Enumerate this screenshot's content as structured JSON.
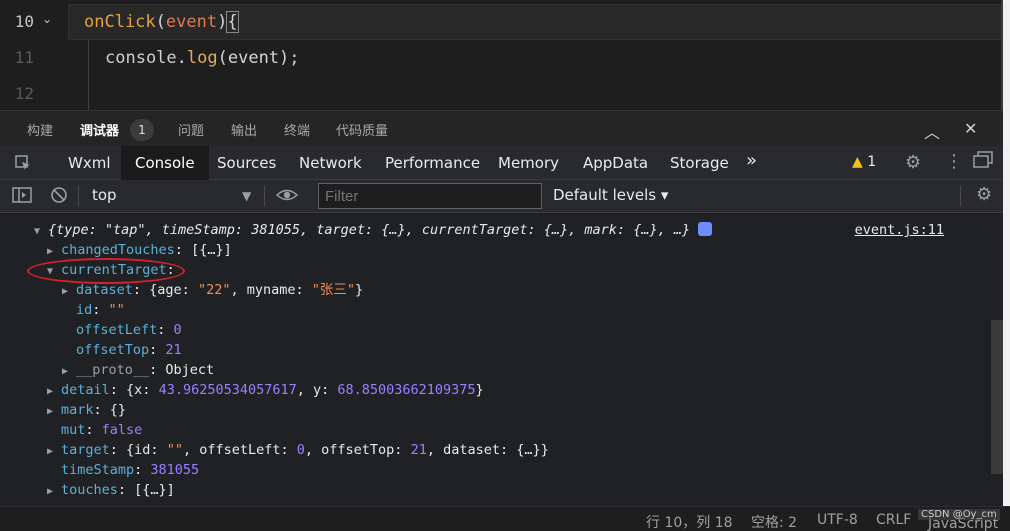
{
  "editor": {
    "lines": [
      {
        "num": "10",
        "active": true
      },
      {
        "num": "11",
        "active": false
      },
      {
        "num": "12",
        "active": false
      }
    ],
    "code_line10": {
      "func": "onClick",
      "open_paren": "(",
      "param": "event",
      "close_paren": ")",
      "brace": "{"
    },
    "code_line11": {
      "obj": "console",
      "dot": ".",
      "method": "log",
      "args": "(event);"
    }
  },
  "panel_tabs": {
    "items": [
      "构建",
      "调试器",
      "问题",
      "输出",
      "终端",
      "代码质量"
    ],
    "active": "调试器",
    "badge": "1",
    "chevron_up": "︿",
    "close": "✕"
  },
  "devtools": {
    "tabs": [
      "Wxml",
      "Console",
      "Sources",
      "Network",
      "Performance",
      "Memory",
      "AppData",
      "Storage"
    ],
    "active_tab": "Console",
    "more": "»",
    "warning_count": "1"
  },
  "console_toolbar": {
    "context": "top",
    "filter_placeholder": "Filter",
    "levels": "Default levels ▾"
  },
  "console": {
    "summary": {
      "text": "{type: \"tap\", timeStamp: 381055, target: {…}, currentTarget: {…}, mark: {…}, …}",
      "source": "event.js:11"
    },
    "changedTouches": {
      "key": "changedTouches",
      "value": "[{…}]"
    },
    "currentTarget": {
      "key": "currentTarget",
      "colon": ":"
    },
    "dataset": {
      "key": "dataset",
      "pre": "{age: ",
      "age": "\"22\"",
      "mid": ", myname: ",
      "myname": "\"张三\"",
      "post": "}"
    },
    "id": {
      "key": "id",
      "value": "\"\""
    },
    "offsetLeft": {
      "key": "offsetLeft",
      "value": "0"
    },
    "offsetTop": {
      "key": "offsetTop",
      "value": "21"
    },
    "proto": {
      "key": "__proto__",
      "value": "Object"
    },
    "detail": {
      "key": "detail",
      "pre": "{x: ",
      "x": "43.96250534057617",
      "mid": ", y: ",
      "y": "68.85003662109375",
      "post": "}"
    },
    "mark": {
      "key": "mark",
      "value": "{}"
    },
    "mut": {
      "key": "mut",
      "value": "false"
    },
    "target": {
      "key": "target",
      "p1": "{id: ",
      "id": "\"\"",
      "p2": ", offsetLeft: ",
      "ol": "0",
      "p3": ", offsetTop: ",
      "ot": "21",
      "p4": ", dataset: {…}}"
    },
    "timeStamp": {
      "key": "timeStamp",
      "value": "381055"
    },
    "touches": {
      "key": "touches",
      "value": "[{…}]"
    }
  },
  "status": {
    "position": "行 10，列 18",
    "spaces": "空格: 2",
    "encoding": "UTF-8",
    "eol": "CRLF",
    "language": "JavaScript",
    "watermark": "CSDN @Oy_cm"
  }
}
